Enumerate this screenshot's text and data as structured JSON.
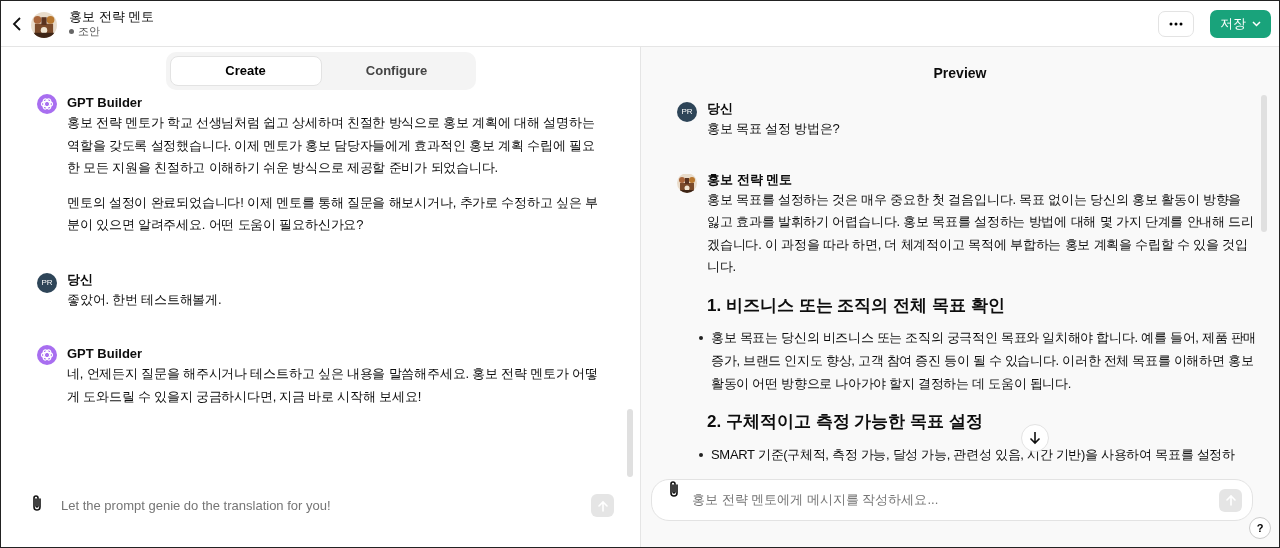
{
  "header": {
    "title": "홍보 전략 멘토",
    "status": "조안",
    "save_label": "저장"
  },
  "tabs": [
    {
      "label": "Create",
      "selected": true
    },
    {
      "label": "Configure",
      "selected": false
    }
  ],
  "builder_chat": [
    {
      "sender": "GPT Builder",
      "avatar": {
        "kind": "builder"
      },
      "paragraphs": [
        "홍보 전략 멘토가 학교 선생님처럼 쉽고 상세하며 친절한 방식으로 홍보 계획에 대해 설명하는 역할을 갖도록 설정했습니다. 이제 멘토가 홍보 담당자들에게 효과적인 홍보 계획 수립에 필요한 모든 지원을 친절하고 이해하기 쉬운 방식으로 제공할 준비가 되었습니다.",
        "멘토의 설정이 완료되었습니다! 이제 멘토를 통해 질문을 해보시거나, 추가로 수정하고 싶은 부분이 있으면 알려주세요. 어떤 도움이 필요하신가요?"
      ]
    },
    {
      "sender": "당신",
      "avatar": {
        "kind": "user",
        "initials": "PR"
      },
      "paragraphs": [
        "좋았어. 한번 테스트해볼게."
      ]
    },
    {
      "sender": "GPT Builder",
      "avatar": {
        "kind": "builder"
      },
      "paragraphs": [
        "네, 언제든지 질문을 해주시거나 테스트하고 싶은 내용을 말씀해주세요. 홍보 전략 멘토가 어떻게 도와드릴 수 있을지 궁금하시다면, 지금 바로 시작해 보세요!"
      ]
    }
  ],
  "builder_composer": {
    "placeholder": "Let the prompt genie do the translation for you!"
  },
  "preview": {
    "title": "Preview",
    "messages": [
      {
        "sender": "당신",
        "avatar": {
          "kind": "user",
          "initials": "PR"
        },
        "blocks": [
          {
            "kind": "paragraph",
            "text": "홍보 목표 설정 방법은?"
          }
        ]
      },
      {
        "sender": "홍보 전략 멘토",
        "blocks": [
          {
            "kind": "paragraph",
            "text": "홍보 목표를 설정하는 것은 매우 중요한 첫 걸음입니다. 목표 없이는 당신의 홍보 활동이 방향을 잃고 효과를 발휘하기 어렵습니다. 홍보 목표를 설정하는 방법에 대해 몇 가지 단계를 안내해 드리겠습니다. 이 과정을 따라 하면, 더 체계적이고 목적에 부합하는 홍보 계획을 수립할 수 있을 것입니다."
          },
          {
            "kind": "heading",
            "text": "1. 비즈니스 또는 조직의 전체 목표 확인"
          },
          {
            "kind": "bullet",
            "text": "홍보 목표는 당신의 비즈니스 또는 조직의 궁극적인 목표와 일치해야 합니다. 예를 들어, 제품 판매 증가, 브랜드 인지도 향상, 고객 참여 증진 등이 될 수 있습니다. 이러한 전체 목표를 이해하면 홍보 활동이 어떤 방향으로 나아가야 할지 결정하는 데 도움이 됩니다."
          },
          {
            "kind": "heading",
            "text": "2. 구체적이고 측정 가능한 목표 설정"
          },
          {
            "kind": "bullet",
            "text": "SMART 기준(구체적, 측정 가능, 달성 가능, 관련성 있음, 시간 기반)을 사용하여 목표를 설정하"
          }
        ]
      }
    ]
  },
  "composer": {
    "placeholder": "홍보 전략 멘토에게 메시지를 작성하세요..."
  },
  "help_label": "?"
}
